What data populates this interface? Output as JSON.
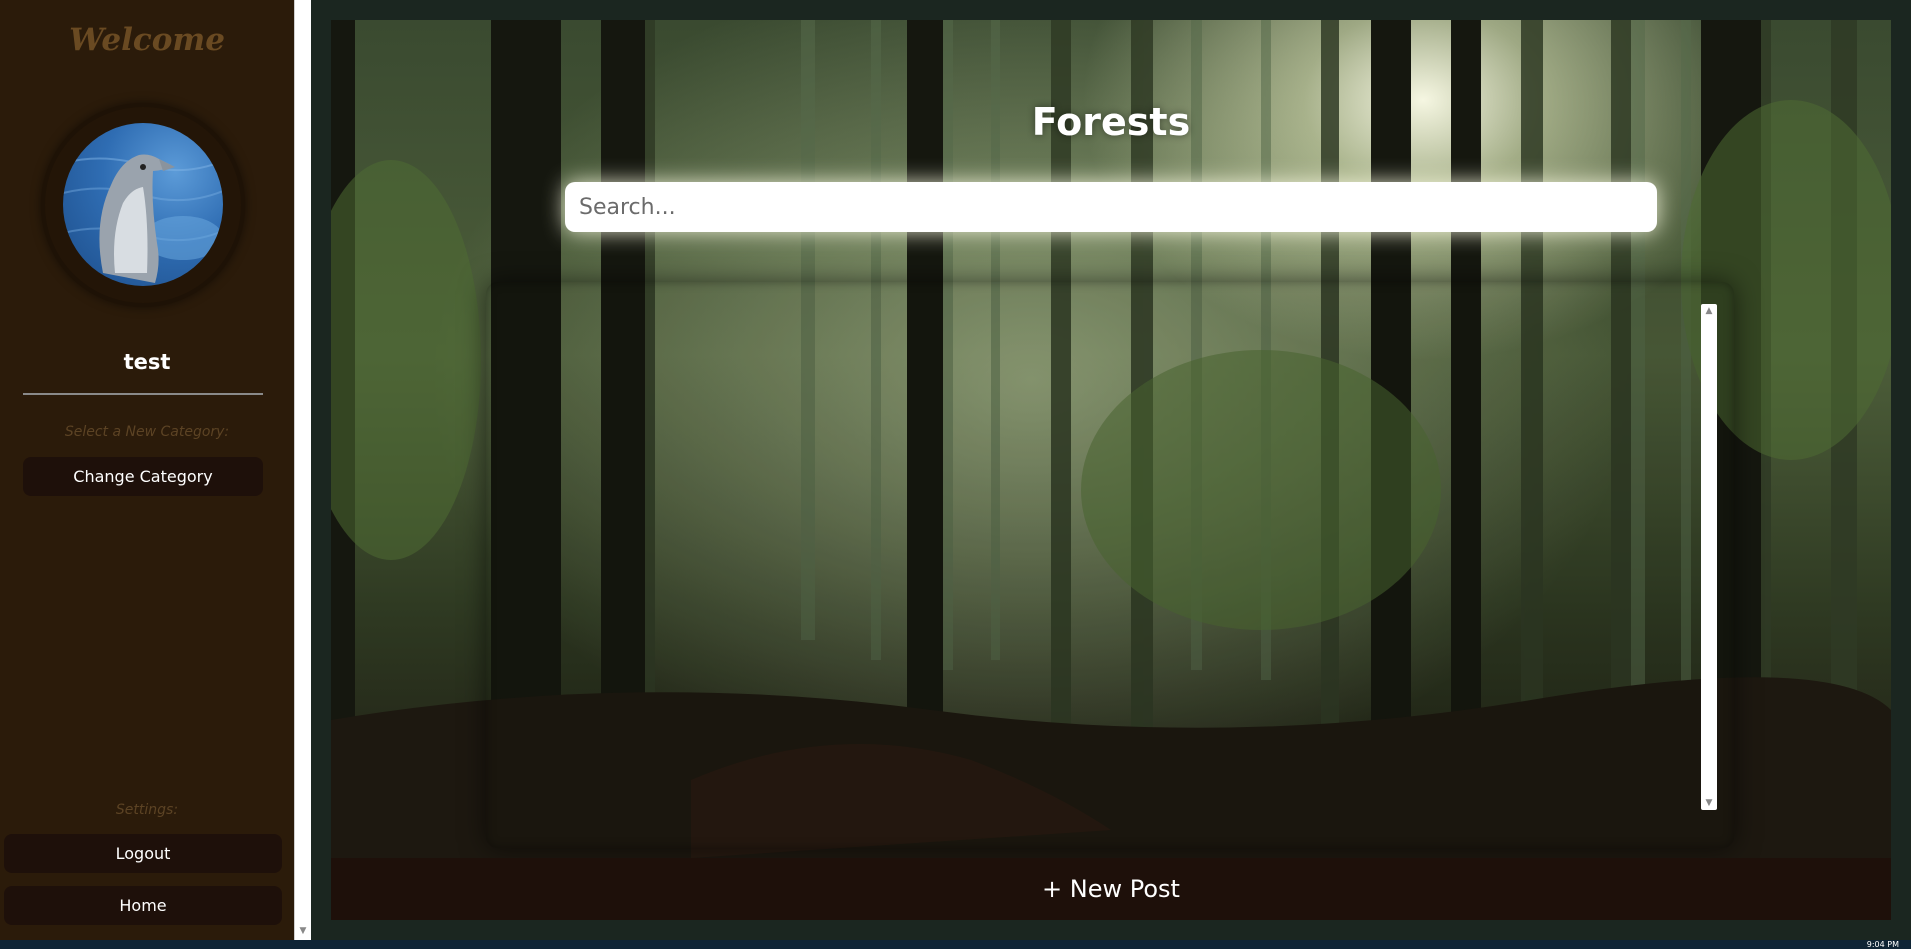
{
  "sidebar": {
    "welcome": "Welcome",
    "username": "test",
    "category_label": "Select a New Category:",
    "change_category": "Change Category",
    "settings_label": "Settings:",
    "logout": "Logout",
    "home": "Home"
  },
  "main": {
    "title": "Forests",
    "search_placeholder": "Search...",
    "new_post": "+ New Post"
  },
  "taskbar": {
    "clock": "9:04 PM"
  },
  "colors": {
    "sidebar_bg": "#2b1b0a",
    "button_bg": "#1e100a",
    "welcome_text": "#6a4a22",
    "main_bg": "#1b2620"
  }
}
